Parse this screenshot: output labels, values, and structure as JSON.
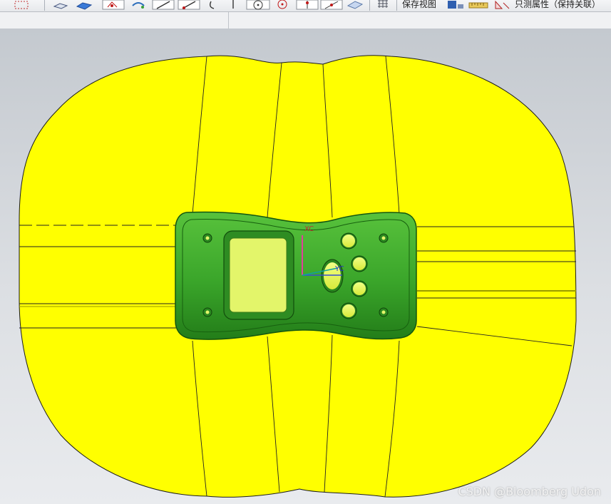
{
  "toolbar": {
    "label_1": "保存视图",
    "label_2": "只测属性（保持关联）"
  },
  "viewport": {
    "axis_x_label": "XC",
    "axis_y_label": "YC"
  },
  "watermark": "CSDN @Bloomberg Udon",
  "colors": {
    "parting_surface": "#ffff00",
    "part_body": "#3fae2e",
    "screen": "#e3f56a"
  }
}
